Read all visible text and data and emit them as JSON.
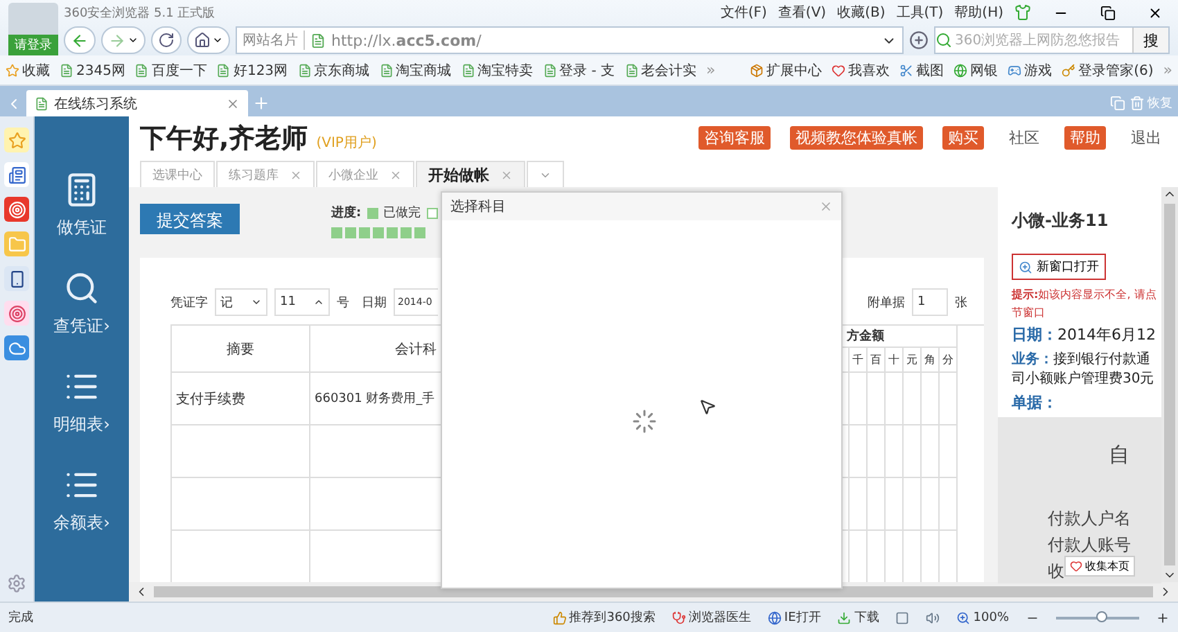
{
  "window": {
    "title": "360安全浏览器 5.1 正式版",
    "login": "请登录",
    "menu": [
      "文件(F)",
      "查看(V)",
      "收藏(B)",
      "工具(T)",
      "帮助(H)"
    ]
  },
  "address": {
    "site_card": "网站名片",
    "url": "http://lx.**acc5.com**/",
    "search_placeholder": "360浏览器上网防忽悠报告",
    "search_button": "搜"
  },
  "bookmarks": {
    "left": [
      "收藏",
      "2345网",
      "百度一下",
      "好123网",
      "京东商城",
      "淘宝商城",
      "淘宝特卖",
      "登录 - 支",
      "老会计实"
    ],
    "more": "»",
    "right": [
      "扩展中心",
      "我喜欢",
      "截图",
      "网银",
      "游戏",
      "登录管家(6)"
    ]
  },
  "browser_tabs": [
    {
      "title": "在线练习系统",
      "selected": true
    }
  ],
  "restore": "恢复",
  "nav": [
    {
      "label": "做凭证",
      "kind": "doc"
    },
    {
      "label": "查凭证›",
      "kind": "search"
    },
    {
      "label": "明细表›",
      "kind": "list"
    },
    {
      "label": "余额表›",
      "kind": "list"
    }
  ],
  "header": {
    "greeting": "下午好,齐老师",
    "badge": "(VIP用户)",
    "links": [
      {
        "label": "咨询客服",
        "kind": "badge"
      },
      {
        "label": "视频教您体验真帐",
        "kind": "badge"
      },
      {
        "label": "购买",
        "kind": "badge"
      },
      {
        "label": "社区",
        "kind": "plain"
      },
      {
        "label": "帮助",
        "kind": "badge"
      },
      {
        "label": "退出",
        "kind": "plain"
      }
    ]
  },
  "page_tabs": [
    {
      "label": "选课中心",
      "closable": false,
      "selected": false
    },
    {
      "label": "练习题库",
      "closable": true,
      "selected": false
    },
    {
      "label": "小微企业",
      "closable": true,
      "selected": false
    },
    {
      "label": "开始做帐",
      "closable": true,
      "selected": true
    }
  ],
  "submit": "提交答案",
  "progress": {
    "label": "进度:",
    "done_label": "已做完",
    "cells": [
      {
        "done": true
      },
      {
        "done": true
      },
      {
        "done": true
      },
      {
        "done": true
      },
      {
        "done": true
      },
      {
        "done": true
      },
      {
        "done": true
      }
    ]
  },
  "voucher": {
    "word_label": "凭证字",
    "word": "记",
    "number": "11",
    "number_label": "号",
    "date_label": "日期",
    "date": "2014-0",
    "attach_label": "附单据",
    "attach": "1",
    "attach_unit": "张",
    "columns": [
      "摘要",
      "会计科"
    ],
    "amount_heading": "方金额",
    "digits": [
      "千",
      "百",
      "十",
      "元",
      "角",
      "分"
    ],
    "rows": [
      {
        "summary": "支付手续费",
        "account": "660301 财务费用_手"
      },
      {
        "summary": "",
        "account": ""
      },
      {
        "summary": "",
        "account": ""
      },
      {
        "summary": "",
        "account": ""
      }
    ]
  },
  "dialog": {
    "title": "选择科目",
    "loading": true
  },
  "task": {
    "title": "小微-业务11",
    "open_new": "新窗口打开",
    "hint": [
      "**提示:**如该内容显示不全, 请点",
      "节窗口"
    ],
    "date_label": "日期：",
    "date": "2014年6月12",
    "business_label": "业务：",
    "business": [
      "接到银行付款通",
      "司小额账户管理费30元"
    ],
    "docs_label": "单据：",
    "doc_lines": [
      "自",
      "付款人户名",
      "付款人账号",
      "收"
    ],
    "collect": "收集本页"
  },
  "status_bar": {
    "text": "完成",
    "items": [
      "推荐到360搜索",
      "浏览器医生",
      "IE打开",
      "下载"
    ],
    "zoom": "100%",
    "zoom_slider": {
      "level": 0.55
    }
  }
}
